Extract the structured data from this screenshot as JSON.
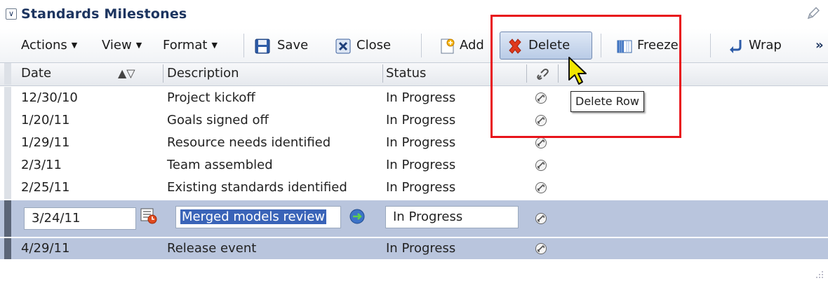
{
  "panel": {
    "title": "Standards Milestones",
    "collapse_glyph": "∨"
  },
  "toolbar": {
    "actions_label": "Actions",
    "view_label": "View",
    "format_label": "Format",
    "save_label": "Save",
    "close_label": "Close",
    "add_label": "Add",
    "delete_label": "Delete",
    "freeze_label": "Freeze",
    "wrap_label": "Wrap",
    "overflow_glyph": "»"
  },
  "table": {
    "columns": [
      "Date",
      "Description",
      "Status"
    ],
    "sort_glyph": "▲▽",
    "rows": [
      {
        "date": "12/30/10",
        "description": "Project kickoff",
        "status": "In Progress"
      },
      {
        "date": "1/20/11",
        "description": "Goals signed off",
        "status": "In Progress"
      },
      {
        "date": "1/29/11",
        "description": "Resource needs identified",
        "status": "In Progress"
      },
      {
        "date": "2/3/11",
        "description": "Team assembled",
        "status": "In Progress"
      },
      {
        "date": "2/25/11",
        "description": "Existing standards identified",
        "status": "In Progress"
      },
      {
        "date": "3/24/11",
        "description": "Merged models review",
        "status": "In Progress"
      },
      {
        "date": "4/29/11",
        "description": "Release event",
        "status": "In Progress"
      }
    ]
  },
  "tooltip": {
    "text": "Delete Row"
  },
  "colors": {
    "title": "#1d3560",
    "selected_row": "#b9c5dd",
    "highlight_box": "#e8141b",
    "text_selection": "#3a64b8"
  },
  "icons": [
    "pencil-icon",
    "save-icon",
    "close-icon",
    "add-icon",
    "delete-icon",
    "freeze-icon",
    "wrap-icon",
    "link-icon",
    "calendar-icon",
    "refresh-icon",
    "cursor-icon",
    "resize-grip-icon"
  ]
}
